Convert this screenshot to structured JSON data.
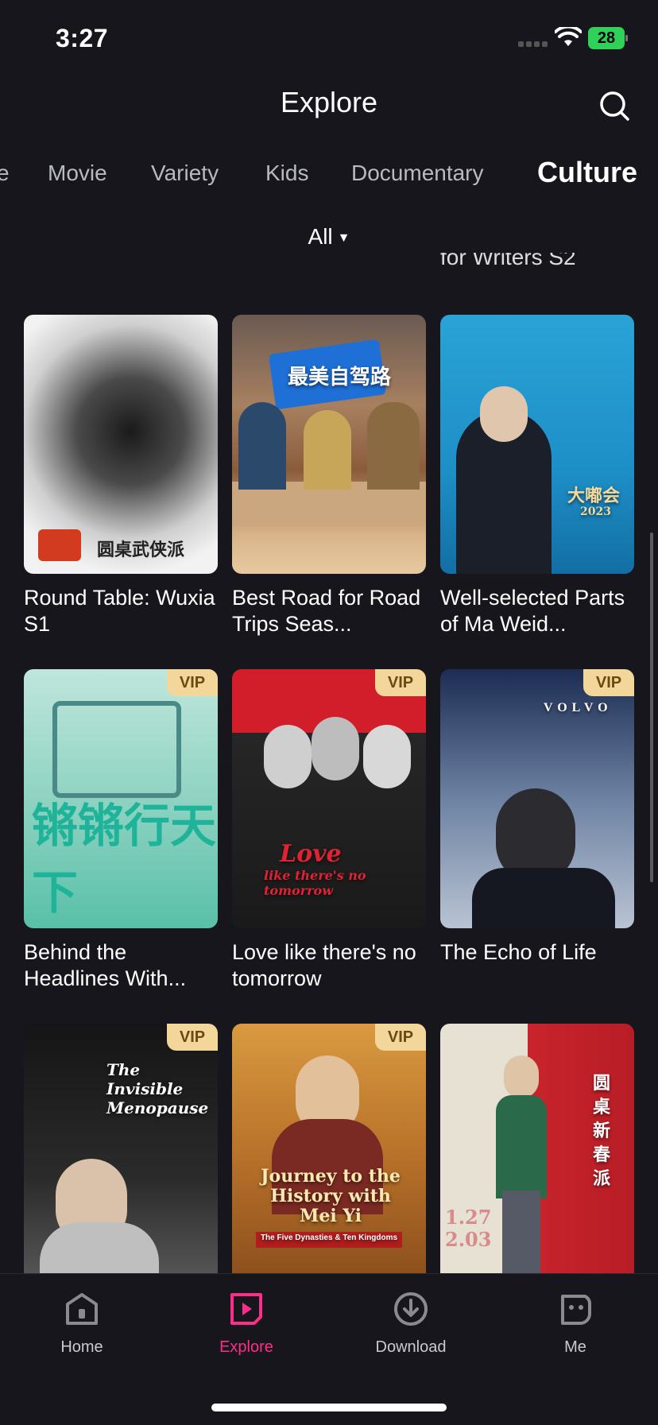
{
  "status": {
    "time": "3:27",
    "battery": "28"
  },
  "header": {
    "title": "Explore"
  },
  "categories": [
    {
      "label": "e",
      "active": false
    },
    {
      "label": "Movie",
      "active": false
    },
    {
      "label": "Variety",
      "active": false
    },
    {
      "label": "Kids",
      "active": false
    },
    {
      "label": "Documentary",
      "active": false
    },
    {
      "label": "Culture",
      "active": true
    }
  ],
  "filter": {
    "label": "All"
  },
  "peek_title": "for Writers S2",
  "badge": "VIP",
  "cards": [
    {
      "title": "Round Table: Wuxia S1",
      "vip": false
    },
    {
      "title": "Best Road for Road Trips Seas...",
      "vip": false
    },
    {
      "title": "Well-selected Parts of Ma Weid...",
      "vip": false
    },
    {
      "title": "Behind the Headlines With...",
      "vip": true
    },
    {
      "title": "Love like there's no tomorrow",
      "vip": true
    },
    {
      "title": "The Echo of Life",
      "vip": true
    },
    {
      "title": "",
      "vip": true
    },
    {
      "title": "",
      "vip": true
    },
    {
      "title": "",
      "vip": false
    }
  ],
  "poster_texts": {
    "p2_cn": "最美自驾路",
    "p3_cn": "大嘟会",
    "p3_year": "2023",
    "p4_cn": "锵锵行天下",
    "p5_love": "Love",
    "p5_sub": "like there's no tomorrow",
    "p6_logo": "VOLVO",
    "p7_title": "The Invisible Menopause",
    "p8_title": "Journey to the History with Mei Yi",
    "p8_sub": "The Five Dynasties & Ten Kingdoms",
    "p9_cn": "圆桌新春派",
    "p9_date": "1.27 2.03",
    "p1_cn": "圆桌武侠派"
  },
  "tabs": [
    {
      "label": "Home",
      "icon": "home-icon",
      "active": false
    },
    {
      "label": "Explore",
      "icon": "explore-icon",
      "active": true
    },
    {
      "label": "Download",
      "icon": "download-icon",
      "active": false
    },
    {
      "label": "Me",
      "icon": "me-icon",
      "active": false
    }
  ],
  "colors": {
    "accent": "#ff2d8a",
    "vip_bg": "#f3d69a",
    "background": "#16161c"
  }
}
